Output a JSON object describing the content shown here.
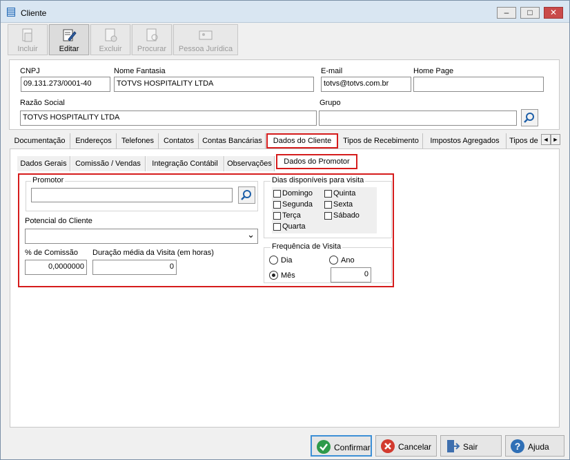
{
  "window": {
    "title": "Cliente",
    "minimize": "–",
    "restore": "□",
    "close": "✕"
  },
  "toolbar": [
    {
      "label": "Incluir",
      "icon": "new-document-icon",
      "enabled": false
    },
    {
      "label": "Editar",
      "icon": "edit-pen-icon",
      "enabled": true
    },
    {
      "label": "Excluir",
      "icon": "delete-document-icon",
      "enabled": false
    },
    {
      "label": "Procurar",
      "icon": "search-document-icon",
      "enabled": false
    },
    {
      "label": "Pessoa Jurídica",
      "icon": "company-card-icon",
      "enabled": false
    }
  ],
  "header": {
    "cnpj": {
      "label": "CNPJ",
      "value": "09.131.273/0001-40"
    },
    "nome_fantasia": {
      "label": "Nome Fantasia",
      "value": "TOTVS HOSPITALITY LTDA"
    },
    "email": {
      "label": "E-mail",
      "value": "totvs@totvs.com.br"
    },
    "home_page": {
      "label": "Home Page",
      "value": ""
    },
    "razao_social": {
      "label": "Razão Social",
      "value": "TOTVS HOSPITALITY LTDA"
    },
    "grupo": {
      "label": "Grupo",
      "value": ""
    }
  },
  "tabs": [
    "Documentação",
    "Endereços",
    "Telefones",
    "Contatos",
    "Contas Bancárias",
    "Dados do Cliente",
    "Tipos de Recebimento",
    "Impostos Agregados",
    "Tipos de"
  ],
  "scroll": {
    "left": "◄",
    "right": "►"
  },
  "subtabs": [
    "Dados Gerais",
    "Comissão / Vendas",
    "Integração Contábil",
    "Observações",
    "Dados do Promotor"
  ],
  "promotor": {
    "group_title": "Promotor",
    "value": "",
    "potencial_label": "Potencial do Cliente",
    "potencial_value": "",
    "dropdown_glyph": "⌄",
    "comissao_label": "% de Comissão",
    "comissao_value": "0,0000000",
    "duracao_label": "Duração média da Visita (em horas)",
    "duracao_value": "0"
  },
  "dias": {
    "title": "Dias disponíveis para visita",
    "items": [
      "Domingo",
      "Segunda",
      "Terça",
      "Quarta",
      "Quinta",
      "Sexta",
      "Sábado"
    ]
  },
  "frequencia": {
    "title": "Frequência de Visita",
    "dia": "Dia",
    "ano": "Ano",
    "mes": "Mês",
    "selected": "Mês",
    "value": "0"
  },
  "buttons": {
    "confirmar": "Confirmar",
    "cancelar": "Cancelar",
    "sair": "Sair",
    "ajuda": "Ajuda"
  },
  "colors": {
    "highlight": "#d51b1b",
    "focus": "#3c8fd6"
  }
}
